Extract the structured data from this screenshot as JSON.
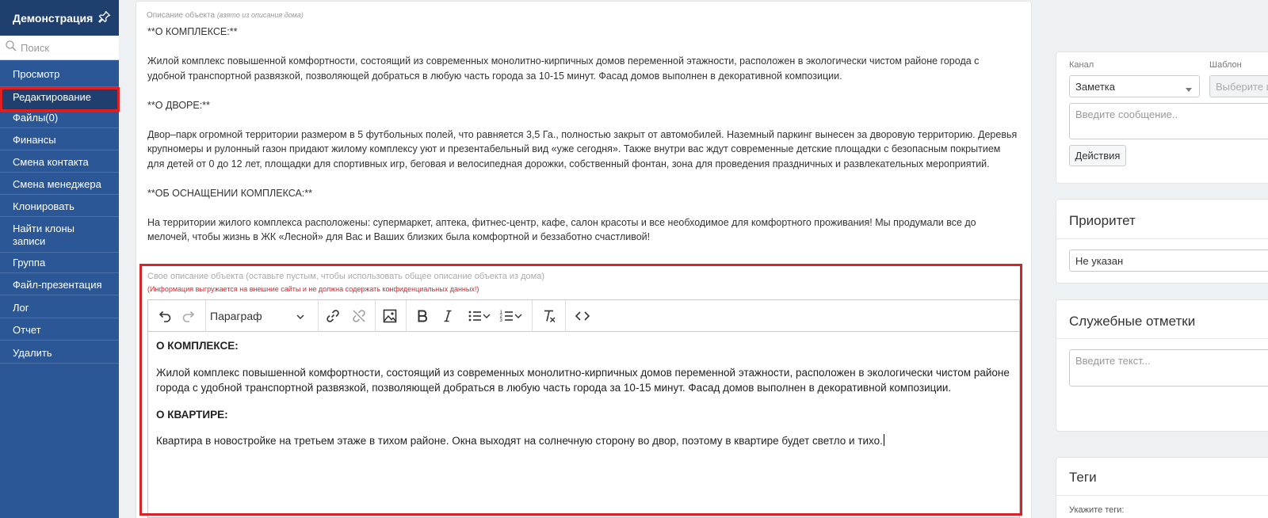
{
  "sidebar": {
    "title": "Демонстрация",
    "search_placeholder": "Поиск",
    "items": [
      {
        "label": "Просмотр"
      },
      {
        "label": "Редактирование"
      },
      {
        "label": "Файлы(0)"
      },
      {
        "label": "Финансы"
      },
      {
        "label": "Смена контакта"
      },
      {
        "label": "Смена менеджера"
      },
      {
        "label": "Клонировать"
      },
      {
        "label": "Найти клоны записи"
      },
      {
        "label": "Группа"
      },
      {
        "label": "Файл-презентация"
      },
      {
        "label": "Лог"
      },
      {
        "label": "Отчет"
      },
      {
        "label": "Удалить"
      }
    ],
    "active_item": "Редактирование"
  },
  "description": {
    "label": "Описание объекта",
    "label_note": "(взято из описания дома)",
    "paragraphs": [
      "**О КОМПЛЕКСЕ:**",
      "Жилой комплекс повышенной комфортности, состоящий из современных монолитно-кирпичных домов переменной этажности, расположен в экологически чистом районе города с удобной транспортной развязкой, позволяющей добраться в любую часть города за 10-15 минут. Фасад домов выполнен в декоративной композиции.",
      "**О ДВОРЕ:**",
      "Двор–парк огромной территории размером в 5 футбольных полей, что равняется 3,5 Га., полностью закрыт от автомобилей. Наземный паркинг вынесен за дворовую территорию. Деревья крупномеры и рулонный газон придают жилому комплексу уют и презентабельный вид «уже сегодня». Также внутри вас ждут современные детские площадки с безопасным покрытием для детей от 0 до 12 лет, площадки для спортивных игр, беговая и велосипедная дорожки, собственный фонтан, зона для проведения праздничных и развлекательных мероприятий.",
      "**ОБ ОСНАЩЕНИИ КОМПЛЕКСА:**",
      "На территории жилого комплекса расположены: супермаркет, аптека, фитнес-центр, кафе, салон красоты и все необходимое для комфортного проживания! Мы продумали все до мелочей, чтобы жизнь в ЖК «Лесной» для Вас и Ваших близких была комфортной и беззаботно счастливой!"
    ]
  },
  "own_description": {
    "label": "Свое описание объекта (оставьте пустым, чтобы использовать общее описание объекта из дома)",
    "warning": "(Информация выгружается на внешние сайты и не должна содержать конфиденциальных данных!)"
  },
  "editor": {
    "format_select": "Параграф",
    "toolbar_icons": [
      "undo-icon",
      "redo-icon",
      "link-icon",
      "unlink-icon",
      "image-icon",
      "bold-icon",
      "italic-icon",
      "bulleted-list-icon",
      "numbered-list-icon",
      "remove-format-icon",
      "source-code-icon"
    ],
    "content": {
      "h1": "О КОМПЛЕКСЕ:",
      "p1": "Жилой комплекс повышенной комфортности, состоящий из современных монолитно-кирпичных домов переменной этажности, расположен в экологически чистом районе города с удобной транспортной развязкой, позволяющей добраться в любую часть города за 10-15 минут. Фасад домов выполнен в декоративной композиции.",
      "h2": "О КВАРТИРЕ:",
      "p2": "Квартира в новостройке на третьем этаже в тихом районе. Окна выходят на солнечную сторону во двор, поэтому в квартире будет светло и тихо."
    }
  },
  "right": {
    "channel_label": "Канал",
    "template_label": "Шаблон",
    "channel_value": "Заметка",
    "template_placeholder": "Выберите ш",
    "message_placeholder": "Введите сообщение..",
    "actions_button": "Действия",
    "priority_title": "Приоритет",
    "priority_value": "Не указан",
    "notes_title": "Служебные отметки",
    "notes_placeholder": "Введите текст...",
    "tags_title": "Теги",
    "tags_label": "Укажите теги:"
  },
  "colors": {
    "sidebar_bg": "#2b5797",
    "sidebar_header_bg": "#1f3f6e",
    "highlight_red": "#d9232a",
    "warning_red": "#d9232a"
  }
}
